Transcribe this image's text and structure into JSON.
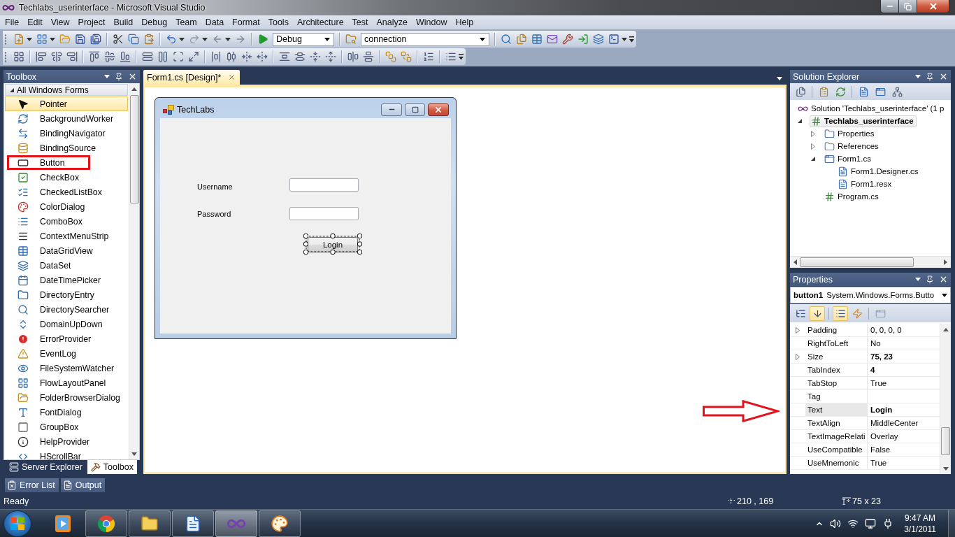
{
  "window": {
    "title": "Techlabs_userinterface - Microsoft Visual Studio"
  },
  "menu": [
    "File",
    "Edit",
    "View",
    "Project",
    "Build",
    "Debug",
    "Team",
    "Data",
    "Format",
    "Tools",
    "Architecture",
    "Test",
    "Analyze",
    "Window",
    "Help"
  ],
  "toolbar": {
    "configuration": "Debug",
    "find_combo": "connection"
  },
  "toolbox": {
    "title": "Toolbox",
    "group": {
      "label": "All Windows Forms",
      "expanded": true
    },
    "items": [
      {
        "label": "Pointer",
        "selected": true,
        "marked": false
      },
      {
        "label": "BackgroundWorker",
        "selected": false,
        "marked": false
      },
      {
        "label": "BindingNavigator",
        "selected": false,
        "marked": false
      },
      {
        "label": "BindingSource",
        "selected": false,
        "marked": false
      },
      {
        "label": "Button",
        "selected": false,
        "marked": true
      },
      {
        "label": "CheckBox",
        "selected": false,
        "marked": false
      },
      {
        "label": "CheckedListBox",
        "selected": false,
        "marked": false
      },
      {
        "label": "ColorDialog",
        "selected": false,
        "marked": false
      },
      {
        "label": "ComboBox",
        "selected": false,
        "marked": false
      },
      {
        "label": "ContextMenuStrip",
        "selected": false,
        "marked": false
      },
      {
        "label": "DataGridView",
        "selected": false,
        "marked": false
      },
      {
        "label": "DataSet",
        "selected": false,
        "marked": false
      },
      {
        "label": "DateTimePicker",
        "selected": false,
        "marked": false
      },
      {
        "label": "DirectoryEntry",
        "selected": false,
        "marked": false
      },
      {
        "label": "DirectorySearcher",
        "selected": false,
        "marked": false
      },
      {
        "label": "DomainUpDown",
        "selected": false,
        "marked": false
      },
      {
        "label": "ErrorProvider",
        "selected": false,
        "marked": false
      },
      {
        "label": "EventLog",
        "selected": false,
        "marked": false
      },
      {
        "label": "FileSystemWatcher",
        "selected": false,
        "marked": false
      },
      {
        "label": "FlowLayoutPanel",
        "selected": false,
        "marked": false
      },
      {
        "label": "FolderBrowserDialog",
        "selected": false,
        "marked": false
      },
      {
        "label": "FontDialog",
        "selected": false,
        "marked": false
      },
      {
        "label": "GroupBox",
        "selected": false,
        "marked": false
      },
      {
        "label": "HelpProvider",
        "selected": false,
        "marked": false
      },
      {
        "label": "HScrollBar",
        "selected": false,
        "marked": false
      }
    ],
    "tabs": [
      {
        "label": "Server Explorer",
        "selected": false
      },
      {
        "label": "Toolbox",
        "selected": true
      }
    ]
  },
  "document_tabs": [
    {
      "label": "Form1.cs [Design]*",
      "selected": true
    }
  ],
  "form": {
    "title": "TechLabs",
    "fields": [
      {
        "label": "Username"
      },
      {
        "label": "Password"
      }
    ],
    "button": {
      "label": "Login",
      "selected": true
    }
  },
  "solution_explorer": {
    "title": "Solution Explorer",
    "tree": [
      {
        "label": "Solution 'Techlabs_userinterface' (1 p",
        "kind": "solution",
        "selected": false,
        "children": [
          {
            "label": "Techlabs_userinterface",
            "kind": "project",
            "selected": true,
            "expanded": true,
            "children": [
              {
                "label": "Properties",
                "kind": "folder",
                "selected": false,
                "expanded": false
              },
              {
                "label": "References",
                "kind": "references",
                "selected": false,
                "expanded": false
              },
              {
                "label": "Form1.cs",
                "kind": "form",
                "selected": false,
                "expanded": true,
                "children": [
                  {
                    "label": "Form1.Designer.cs",
                    "kind": "file",
                    "selected": false
                  },
                  {
                    "label": "Form1.resx",
                    "kind": "file",
                    "selected": false
                  }
                ]
              },
              {
                "label": "Program.cs",
                "kind": "code",
                "selected": false
              }
            ]
          }
        ]
      }
    ]
  },
  "properties": {
    "title": "Properties",
    "object": {
      "name": "button1",
      "type": "System.Windows.Forms.Butto"
    },
    "toolbar": [
      {
        "kind": "categorized",
        "on": false,
        "disabled": false
      },
      {
        "kind": "alphabetical",
        "on": true,
        "disabled": false
      },
      {
        "kind": "properties",
        "on": true,
        "disabled": false
      },
      {
        "kind": "events",
        "on": false,
        "disabled": false
      },
      {
        "kind": "pages",
        "on": false,
        "disabled": true
      }
    ],
    "rows": [
      {
        "name": "Padding",
        "value": "0, 0, 0, 0",
        "expandable": true,
        "modified": false,
        "selected": false
      },
      {
        "name": "RightToLeft",
        "value": "No",
        "expandable": false,
        "modified": false,
        "selected": false
      },
      {
        "name": "Size",
        "value": "75, 23",
        "expandable": true,
        "modified": true,
        "selected": false
      },
      {
        "name": "TabIndex",
        "value": "4",
        "expandable": false,
        "modified": true,
        "selected": false
      },
      {
        "name": "TabStop",
        "value": "True",
        "expandable": false,
        "modified": false,
        "selected": false
      },
      {
        "name": "Tag",
        "expandable": false,
        "selected": false
      },
      {
        "name": "Text",
        "value": "Login",
        "expandable": false,
        "modified": true,
        "selected": true
      },
      {
        "name": "TextAlign",
        "value": "MiddleCenter",
        "expandable": false,
        "modified": false,
        "selected": false
      },
      {
        "name": "TextImageRelati",
        "value": "Overlay",
        "expandable": false,
        "modified": false,
        "selected": false
      },
      {
        "name": "UseCompatible",
        "value": "False",
        "expandable": false,
        "modified": false,
        "selected": false
      },
      {
        "name": "UseMnemonic",
        "value": "True",
        "expandable": false,
        "modified": false,
        "selected": false
      }
    ]
  },
  "bottom_tabs": [
    {
      "label": "Error List"
    },
    {
      "label": "Output"
    }
  ],
  "status_bar": {
    "text": "Ready",
    "position": "210 , 169",
    "size": "75 x 23"
  },
  "taskbar": {
    "buttons": [
      {
        "kind": "media",
        "running": false,
        "selected": false
      },
      {
        "kind": "browser",
        "running": true,
        "selected": false
      },
      {
        "kind": "folder",
        "running": true,
        "selected": false
      },
      {
        "kind": "document",
        "running": true,
        "selected": false
      },
      {
        "kind": "studio",
        "running": true,
        "selected": true
      },
      {
        "kind": "paint",
        "running": true,
        "selected": false
      }
    ],
    "time": "9:47 AM",
    "date": "3/1/2011"
  }
}
